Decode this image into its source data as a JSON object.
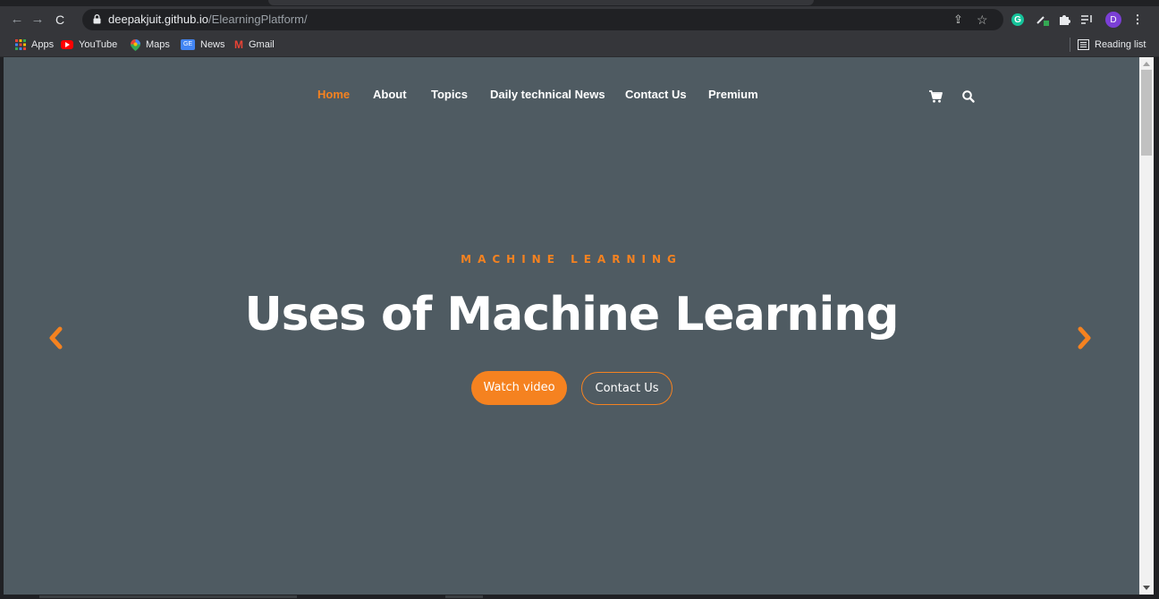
{
  "browser": {
    "url_domain": "deepakjuit.github.io",
    "url_path": "/ElearningPlatform/",
    "avatar_letter": "D",
    "ext_letter": "G",
    "reading_list": "Reading list",
    "bookmarks": [
      {
        "label": "Apps",
        "icon": "apps-grid-icon"
      },
      {
        "label": "YouTube",
        "icon": "youtube-icon"
      },
      {
        "label": "Maps",
        "icon": "maps-pin-icon"
      },
      {
        "label": "News",
        "icon": "google-news-icon"
      },
      {
        "label": "Gmail",
        "icon": "gmail-icon"
      }
    ]
  },
  "nav": {
    "items": [
      "Home",
      "About",
      "Topics",
      "Daily technical News",
      "Contact Us",
      "Premium"
    ],
    "active": "Home"
  },
  "hero": {
    "subtitle": "MACHINE LEARNING",
    "title": "Uses of Machine Learning",
    "primary_button": "Watch video",
    "secondary_button": "Contact Us"
  },
  "colors": {
    "accent": "#f58220",
    "hero_bg": "#4f5b62",
    "chrome_dark": "#202124",
    "chrome_toolbar": "#35363a"
  }
}
